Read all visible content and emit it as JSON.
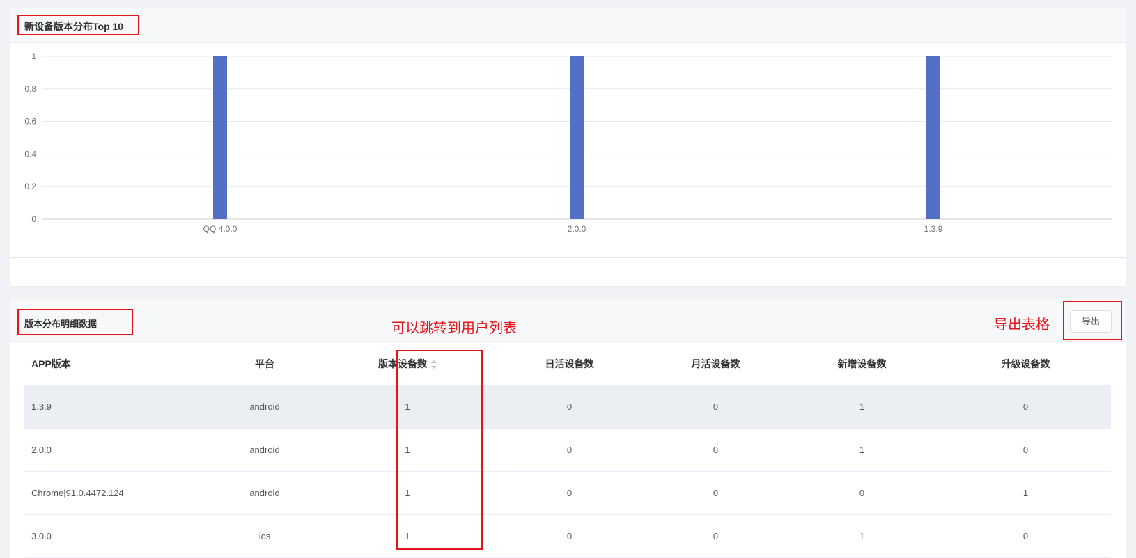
{
  "chart_card": {
    "title": "新设备版本分布Top 10"
  },
  "chart_data": {
    "type": "bar",
    "categories": [
      "QQ 4.0.0",
      "2.0.0",
      "1.3.9"
    ],
    "values": [
      1,
      1,
      1
    ],
    "ylim": [
      0,
      1
    ],
    "yticks": [
      "0",
      "0.2",
      "0.4",
      "0.6",
      "0.8",
      "1"
    ],
    "bar_color": "#5470c6",
    "grid": true
  },
  "table_card": {
    "title": "版本分布明细数据",
    "note_jump": "可以跳转到用户列表",
    "note_export": "导出表格",
    "export_label": "导出",
    "columns": [
      "APP版本",
      "平台",
      "版本设备数",
      "日活设备数",
      "月活设备数",
      "新增设备数",
      "升级设备数"
    ],
    "rows": [
      [
        "1.3.9",
        "android",
        "1",
        "0",
        "0",
        "1",
        "0"
      ],
      [
        "2.0.0",
        "android",
        "1",
        "0",
        "0",
        "1",
        "0"
      ],
      [
        "Chrome|91.0.4472.124",
        "android",
        "1",
        "0",
        "0",
        "0",
        "1"
      ],
      [
        "3.0.0",
        "ios",
        "1",
        "0",
        "0",
        "1",
        "0"
      ]
    ]
  },
  "colors": {
    "annotation_red": "#e5141b",
    "highlight_row": "#ebeef2"
  }
}
